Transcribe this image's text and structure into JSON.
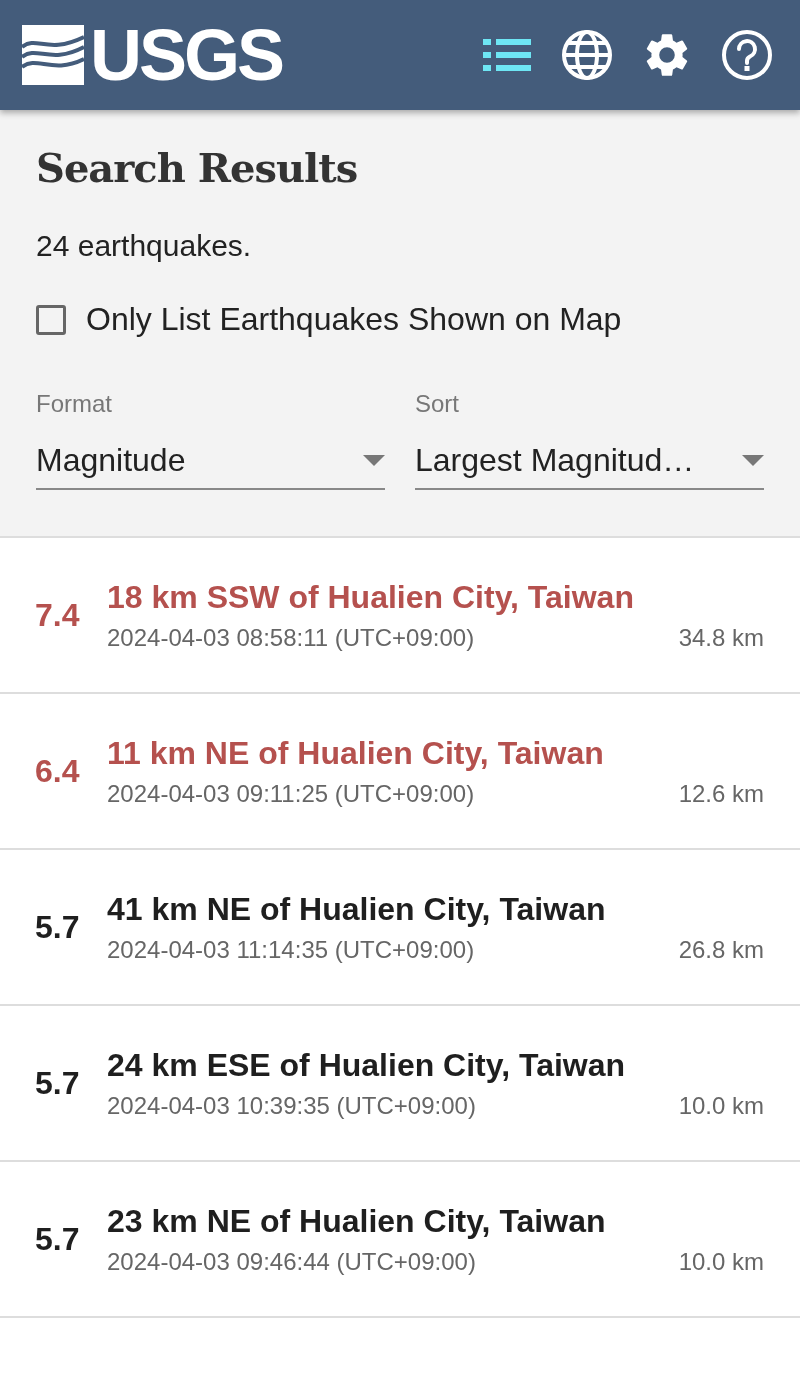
{
  "header": {
    "logo": "USGS",
    "nav": [
      {
        "kind": "list",
        "selected": true
      },
      {
        "kind": "map",
        "selected": false
      },
      {
        "kind": "settings",
        "selected": false
      },
      {
        "kind": "help",
        "selected": false
      }
    ]
  },
  "title": "Search Results",
  "count": "24 earthquakes.",
  "filter": {
    "label": "Only List Earthquakes Shown on Map",
    "checked": false
  },
  "selects": [
    {
      "label": "Format",
      "value": "Magnitude"
    },
    {
      "label": "Sort",
      "value": "Largest Magnitud…"
    }
  ],
  "earthquakes": [
    {
      "magnitude": "7.4",
      "place": "18 km SSW of Hualien City, Taiwan",
      "time": "2024-04-03 08:58:11 (UTC+09:00)",
      "depth": "34.8 km",
      "color": "#b5514e"
    },
    {
      "magnitude": "6.4",
      "place": "11 km NE of Hualien City, Taiwan",
      "time": "2024-04-03 09:11:25 (UTC+09:00)",
      "depth": "12.6 km",
      "color": "#b5514e"
    },
    {
      "magnitude": "5.7",
      "place": "41 km NE of Hualien City, Taiwan",
      "time": "2024-04-03 11:14:35 (UTC+09:00)",
      "depth": "26.8 km",
      "color": "#1f1f1f"
    },
    {
      "magnitude": "5.7",
      "place": "24 km ESE of Hualien City, Taiwan",
      "time": "2024-04-03 10:39:35 (UTC+09:00)",
      "depth": "10.0 km",
      "color": "#1f1f1f"
    },
    {
      "magnitude": "5.7",
      "place": "23 km NE of Hualien City, Taiwan",
      "time": "2024-04-03 09:46:44 (UTC+09:00)",
      "depth": "10.0 km",
      "color": "#1f1f1f"
    }
  ]
}
